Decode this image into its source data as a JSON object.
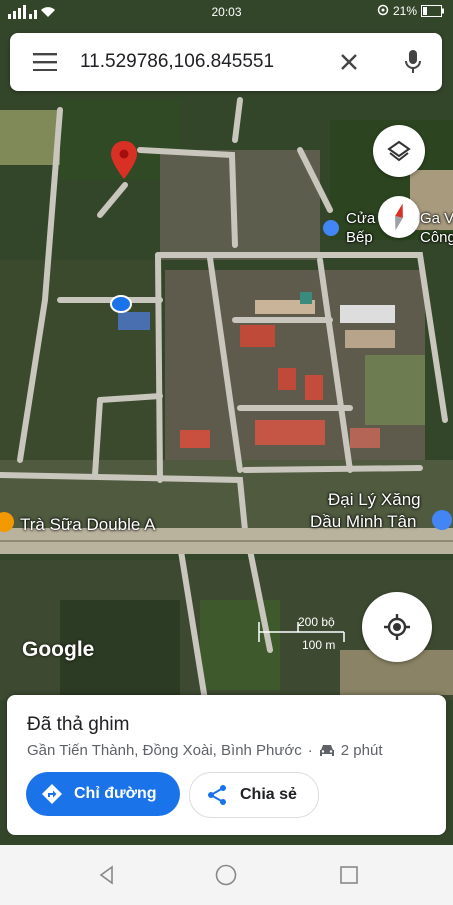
{
  "status_bar": {
    "time": "20:03",
    "battery": "21%"
  },
  "search": {
    "query": "11.529786,106.845551"
  },
  "map": {
    "labels": {
      "poi_1_line1": "Cửa",
      "poi_1_line1b": "Ga V",
      "poi_1_line2": "Bếp",
      "poi_1_line2b": "Công",
      "store": "Trà Sữa Double A",
      "gas_line1": "Đại Lý Xăng",
      "gas_line2": "Dầu Minh Tân"
    },
    "scale": {
      "imperial": "200 bộ",
      "metric": "100 m"
    },
    "brand": "Google"
  },
  "place_sheet": {
    "title": "Đã thả ghim",
    "address": "Gần Tiến Thành, Đồng Xoài, Bình Phước",
    "travel_time": "2 phút",
    "directions_label": "Chỉ đường",
    "share_label": "Chia sẻ"
  },
  "colors": {
    "accent": "#1a73e8",
    "pin": "#d93025",
    "road": "#c9c6bd"
  },
  "icons": [
    "menu-icon",
    "close-icon",
    "mic-icon",
    "layers-icon",
    "compass-icon",
    "my-location-icon",
    "car-icon",
    "directions-icon",
    "share-icon"
  ]
}
